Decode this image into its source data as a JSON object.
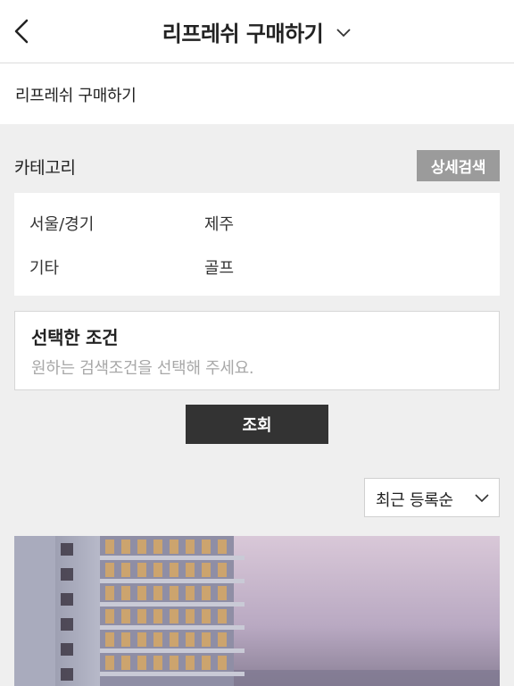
{
  "header": {
    "title": "리프레쉬 구매하기",
    "back_icon": "chevron-left-icon",
    "dropdown_icon": "chevron-down-icon"
  },
  "breadcrumb": {
    "label": "리프레쉬 구매하기"
  },
  "category": {
    "label": "카테고리",
    "detail_search_label": "상세검색",
    "items": [
      "서울/경기",
      "제주",
      "기타",
      "골프"
    ]
  },
  "selected_conditions": {
    "title": "선택한 조건",
    "placeholder": "원하는 검색조건을 선택해 주세요."
  },
  "search_button": {
    "label": "조회"
  },
  "sort": {
    "selected": "최근 등록순"
  },
  "listing": {
    "image": "building-photo"
  },
  "colors": {
    "dark_button": "#333333",
    "detail_button": "#9b9b9b",
    "background": "#efefef"
  }
}
